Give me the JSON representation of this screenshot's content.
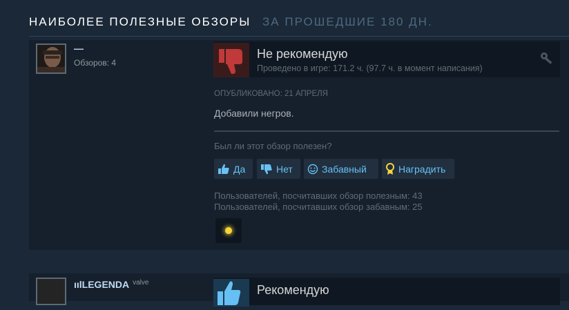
{
  "section": {
    "title": "Наиболее полезные обзоры",
    "subtitle": "за прошедшие 180 дн."
  },
  "review1": {
    "author": "—",
    "reviews_count": "Обзоров: 4",
    "verdict": "Не рекомендую",
    "hours": "Проведено в игре: 171.2 ч. (97.7 ч. в момент написания)",
    "posted": "Опубликовано: 21 апреля",
    "text": "Добавили негров.",
    "helpful_question": "Был ли этот обзор полезен?",
    "buttons": {
      "yes": "Да",
      "no": "Нет",
      "funny": "Забавный",
      "award": "Наградить"
    },
    "helpful_stat": "Пользователей, посчитавших обзор полезным: 43",
    "funny_stat": "Пользователей, посчитавших обзор забавным: 25",
    "colors": {
      "thumb_down_bg": "#3a1b1c",
      "thumb_down": "#c03a3a",
      "link": "#67c1f5",
      "award": "#f7d43a"
    }
  },
  "review2": {
    "author": "ıılLEGENDA",
    "tag": "valve",
    "verdict": "Рекомендую"
  }
}
